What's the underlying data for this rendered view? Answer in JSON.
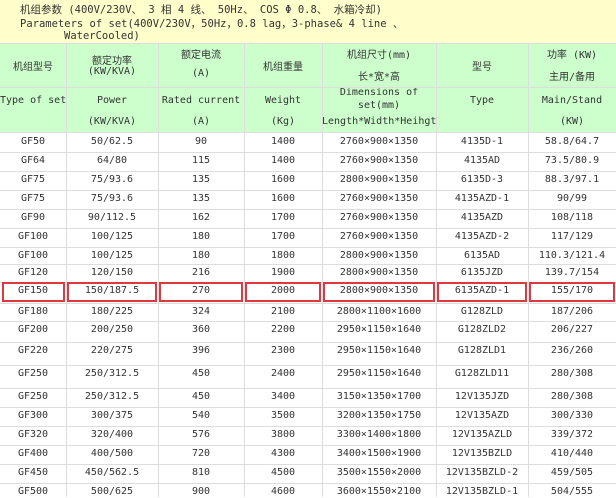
{
  "title": {
    "cn": "机组参数 (400V/230V、 3 相 4 线、 50Hz、 COS Φ 0.8、 水箱冷却)",
    "en1": "Parameters of set(400V/230V，50Hz，0.8 lag，3-phase& 4 line 、",
    "en2": "WaterCooled)"
  },
  "headers": {
    "model": {
      "cn": "机组型号",
      "en": "Type of set"
    },
    "power": {
      "cn": "额定功率",
      "cn2": "(KW/KVA)",
      "en": "Power",
      "en2": "(KW/KVA)"
    },
    "current": {
      "cn": "额定电流",
      "cn2": "(A)",
      "en": "Rated current",
      "en2": "(A)"
    },
    "weight": {
      "cn": "机组重量",
      "en": "Weight",
      "en2": "(Kg)"
    },
    "dims": {
      "cn": "机组尺寸(mm)",
      "cn2": "长*宽*高",
      "en": "Dimensions of",
      "en2": "set(mm)",
      "en3": "Length*Width*Heihgt"
    },
    "type": {
      "cn": "型号",
      "en": "Type"
    },
    "kw": {
      "cn": "功率 (KW)",
      "cn2": "主用/备用",
      "en": "Main/Stand",
      "en2": "(KW)"
    }
  },
  "rows": [
    [
      "GF50",
      "50/62.5",
      "90",
      "1400",
      "2760×900×1350",
      "4135D-1",
      "58.8/64.7"
    ],
    [
      "GF64",
      "64/80",
      "115",
      "1400",
      "2760×900×1350",
      "4135AD",
      "73.5/80.9"
    ],
    [
      "GF75",
      "75/93.6",
      "135",
      "1600",
      "2800×900×1350",
      "6135D-3",
      "88.3/97.1"
    ],
    [
      "GF75",
      "75/93.6",
      "135",
      "1600",
      "2760×900×1350",
      "4135AZD-1",
      "90/99"
    ],
    [
      "GF90",
      "90/112.5",
      "162",
      "1700",
      "2760×900×1350",
      "4135AZD",
      "108/118"
    ],
    [
      "GF100",
      "100/125",
      "180",
      "1700",
      "2760×900×1350",
      "4135AZD-2",
      "117/129"
    ],
    [
      "GF100",
      "100/125",
      "180",
      "1800",
      "2800×900×1350",
      "6135AD",
      "110.3/121.4"
    ],
    [
      "GF120",
      "120/150",
      "216",
      "1900",
      "2800×900×1350",
      "6135JZD",
      "139.7/154"
    ],
    [
      "GF150",
      "150/187.5",
      "270",
      "2000",
      "2800×900×1350",
      "6135AZD-1",
      "155/170"
    ],
    [
      "GF180",
      "180/225",
      "324",
      "2100",
      "2800×1100×1600",
      "G128ZLD",
      "187/206"
    ],
    [
      "GF200",
      "200/250",
      "360",
      "2200",
      "2950×1150×1640",
      "G128ZLD2",
      "206/227"
    ],
    [
      "GF220",
      "220/275",
      "396",
      "2300",
      "2950×1150×1640",
      "G128ZLD1",
      "236/260"
    ],
    [
      "GF250",
      "250/312.5",
      "450",
      "2400",
      "2950×1150×1640",
      "G128ZLD11",
      "280/308"
    ],
    [
      "GF250",
      "250/312.5",
      "450",
      "3400",
      "3150×1350×1700",
      "12V135JZD",
      "280/308"
    ],
    [
      "GF300",
      "300/375",
      "540",
      "3500",
      "3200×1350×1750",
      "12V135AZD",
      "300/330"
    ],
    [
      "GF320",
      "320/400",
      "576",
      "3800",
      "3300×1400×1800",
      "12V135AZLD",
      "339/372"
    ],
    [
      "GF400",
      "400/500",
      "720",
      "4300",
      "3400×1500×1900",
      "12V135BZLD",
      "410/440"
    ],
    [
      "GF450",
      "450/562.5",
      "810",
      "4500",
      "3500×1550×2000",
      "12V135BZLD-2",
      "459/505"
    ],
    [
      "GF500",
      "500/625",
      "900",
      "4600",
      "3600×1550×2100",
      "12V135BZLD-1",
      "504/555"
    ]
  ]
}
